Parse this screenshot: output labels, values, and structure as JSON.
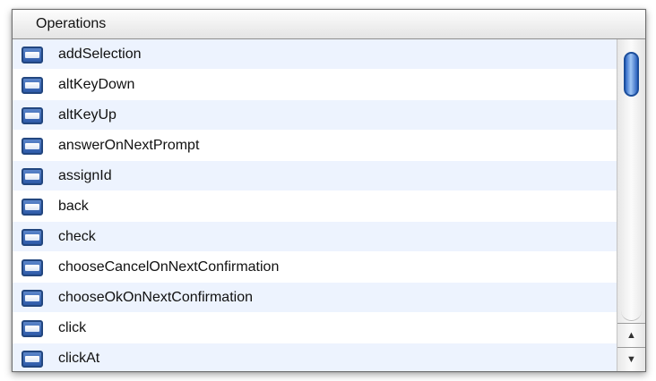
{
  "header": {
    "title": "Operations"
  },
  "operations": [
    {
      "label": "addSelection"
    },
    {
      "label": "altKeyDown"
    },
    {
      "label": "altKeyUp"
    },
    {
      "label": "answerOnNextPrompt"
    },
    {
      "label": "assignId"
    },
    {
      "label": "back"
    },
    {
      "label": "check"
    },
    {
      "label": "chooseCancelOnNextConfirmation"
    },
    {
      "label": "chooseOkOnNextConfirmation"
    },
    {
      "label": "click"
    },
    {
      "label": "clickAt"
    }
  ],
  "icons": {
    "row": "operation-icon",
    "scroll_up": "arrow-up-icon",
    "scroll_down": "arrow-down-icon"
  },
  "scroll_arrows": {
    "up": "▲",
    "down": "▼"
  },
  "colors": {
    "row_alt": "#edf3fe",
    "icon_blue": "#2d5aa8",
    "scroll_thumb": "#2e68c6"
  }
}
